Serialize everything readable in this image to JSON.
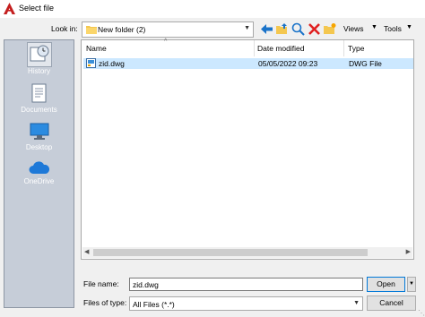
{
  "window": {
    "title": "Select file"
  },
  "lookin": {
    "label": "Look in:",
    "value": "New folder (2)"
  },
  "toolbar": {
    "views_label": "Views",
    "tools_label": "Tools"
  },
  "places": [
    {
      "label": "History"
    },
    {
      "label": "Documents"
    },
    {
      "label": "Desktop"
    },
    {
      "label": "OneDrive"
    }
  ],
  "filelist": {
    "columns": {
      "name": "Name",
      "date": "Date modified",
      "type": "Type"
    },
    "rows": [
      {
        "name": "zid.dwg",
        "date": "05/05/2022 09:23",
        "type": "DWG File"
      }
    ]
  },
  "filename": {
    "label": "File name:",
    "value": "zid.dwg"
  },
  "filetype": {
    "label": "Files of type:",
    "value": "All Files (*.*)"
  },
  "buttons": {
    "open": "Open",
    "cancel": "Cancel"
  },
  "colors": {
    "accent": "#0078d7",
    "selected_row": "#cce8ff",
    "places_bg": "#c6cdd8",
    "app_icon": "#c41e1e"
  }
}
